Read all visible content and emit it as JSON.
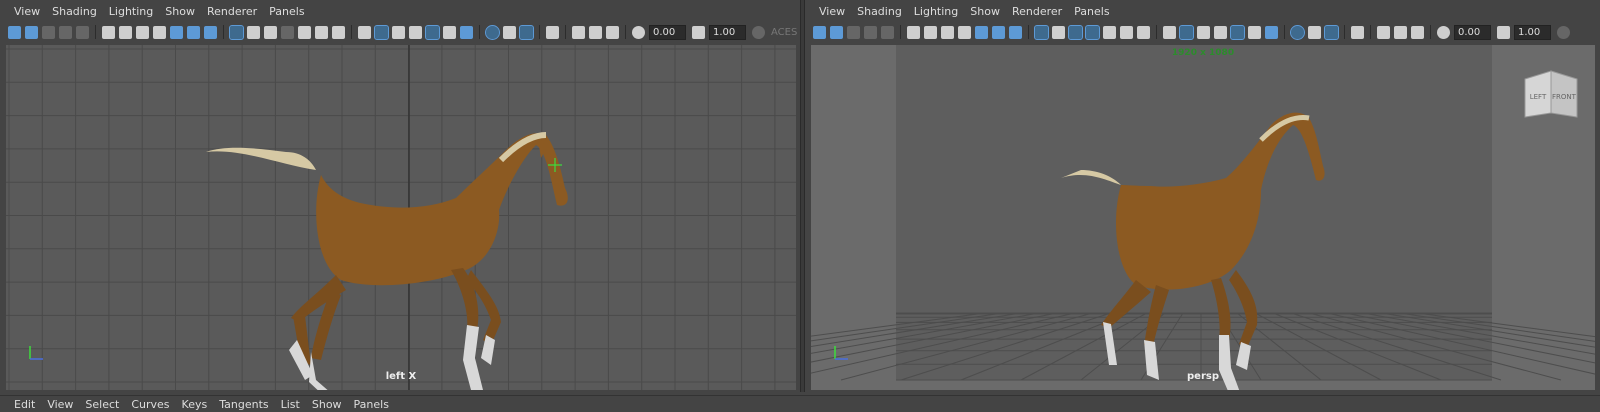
{
  "panel_menu": [
    "View",
    "Shading",
    "Lighting",
    "Show",
    "Renderer",
    "Panels"
  ],
  "toolbar": {
    "exposure_value": "0.00",
    "gamma_value": "1.00",
    "color_space": "ACES"
  },
  "left_viewport": {
    "camera": "left X"
  },
  "right_viewport": {
    "camera": "persp",
    "resolution_gate": "1920 x 1080",
    "viewcube_left": "LEFT",
    "viewcube_front": "FRONT"
  },
  "bottom_menu": [
    "Edit",
    "View",
    "Select",
    "Curves",
    "Keys",
    "Tangents",
    "List",
    "Show",
    "Panels"
  ],
  "colors": {
    "background": "#444444",
    "viewport_left": "#5a5a5a",
    "viewport_right": "#6b6b6b",
    "grid_line": "#4a4a4a",
    "horse_body": "#8c5a22",
    "hoof_white": "#d8d8d8",
    "accent": "#5d9ad6"
  }
}
